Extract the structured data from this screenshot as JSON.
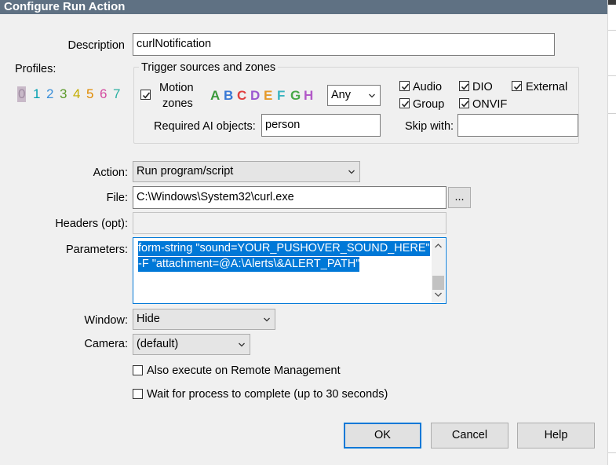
{
  "window": {
    "title": "Configure Run Action"
  },
  "description": {
    "label": "Description",
    "value": "curlNotification"
  },
  "profiles": {
    "label": "Profiles:",
    "items": [
      "0",
      "1",
      "2",
      "3",
      "4",
      "5",
      "6",
      "7"
    ],
    "colors": [
      "#a58fa3",
      "#00a0b0",
      "#3a8fd9",
      "#5b9a2a",
      "#c4ad00",
      "#e08a00",
      "#d44ba0",
      "#2bb0a2"
    ]
  },
  "trigger": {
    "group_title": "Trigger sources and zones",
    "motion_zones": {
      "line1": "Motion",
      "line2": "zones",
      "checked": true
    },
    "zone_letters": [
      "A",
      "B",
      "C",
      "D",
      "E",
      "F",
      "G",
      "H"
    ],
    "zone_colors": [
      "#3a9a3a",
      "#3878d6",
      "#e04040",
      "#9b59d0",
      "#e59a2a",
      "#3ab4c0",
      "#48a848",
      "#b259c8"
    ],
    "zone_match": "Any",
    "sources": [
      {
        "label": "Audio",
        "checked": true
      },
      {
        "label": "DIO",
        "checked": true
      },
      {
        "label": "External",
        "checked": true
      },
      {
        "label": "Group",
        "checked": true
      },
      {
        "label": "ONVIF",
        "checked": true
      }
    ],
    "required_ai_label": "Required AI objects:",
    "required_ai_value": "person",
    "skip_with_label": "Skip with:",
    "skip_with_value": ""
  },
  "action": {
    "label": "Action:",
    "value": "Run program/script"
  },
  "file": {
    "label": "File:",
    "value": "C:\\Windows\\System32\\curl.exe",
    "browse_label": "..."
  },
  "headers": {
    "label": "Headers (opt):",
    "value": ""
  },
  "parameters": {
    "label": "Parameters:",
    "line1": "form-string \"sound=YOUR_PUSHOVER_SOUND_HERE\"",
    "line2": "-F \"attachment=@A:\\Alerts\\&ALERT_PATH\""
  },
  "window_mode": {
    "label": "Window:",
    "value": "Hide"
  },
  "camera": {
    "label": "Camera:",
    "value": "(default)"
  },
  "options": [
    {
      "label": "Also execute on Remote Management",
      "checked": false
    },
    {
      "label": "Wait for process to complete (up to 30 seconds)",
      "checked": false
    }
  ],
  "buttons": {
    "ok": "OK",
    "cancel": "Cancel",
    "help": "Help"
  }
}
